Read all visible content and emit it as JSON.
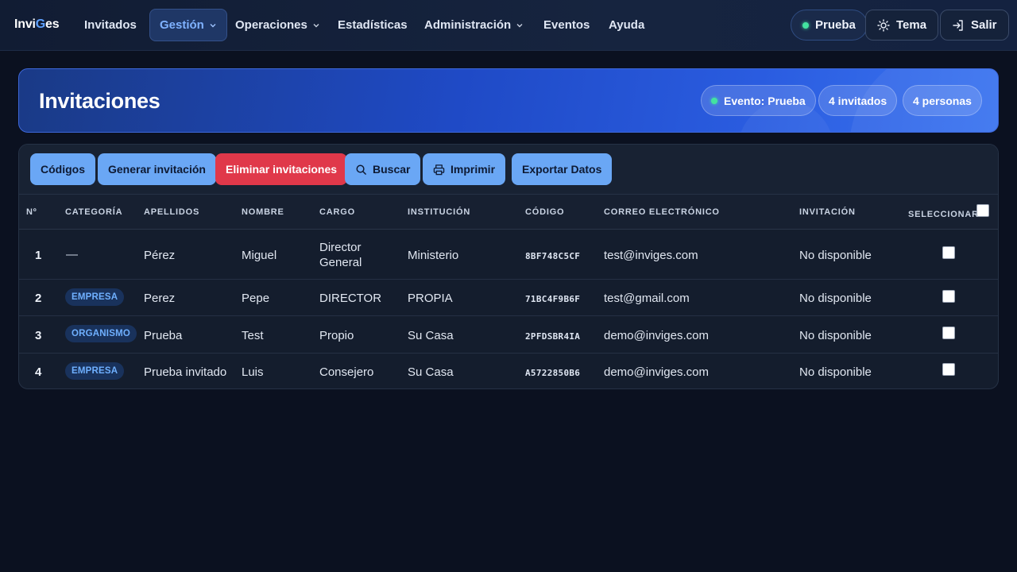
{
  "brand": {
    "part1": "Invi",
    "part2": "G",
    "part3": "es"
  },
  "nav": {
    "items": [
      "Invitados",
      "Gestión",
      "Operaciones",
      "Estadísticas",
      "Administración",
      "Eventos",
      "Ayuda"
    ],
    "active": "Gestión",
    "event_label": "Prueba",
    "theme_label": "Tema",
    "logout_label": "Salir"
  },
  "header": {
    "title": "Invitaciones",
    "event_pill": "Evento: Prueba",
    "guests_pill": "4 invitados",
    "people_pill": "4 personas"
  },
  "toolbar": {
    "codes": "Códigos",
    "generate": "Generar invitación",
    "delete": "Eliminar invitaciones",
    "search": "Buscar",
    "print": "Imprimir",
    "export": "Exportar Datos"
  },
  "table": {
    "headers": {
      "num": "Nº",
      "category": "Categoría",
      "surnames": "Apellidos",
      "name": "Nombre",
      "position": "Cargo",
      "institution": "Institución",
      "code": "Código",
      "email": "Correo electrónico",
      "invitation": "Invitación",
      "select": "Seleccionar"
    },
    "rows": [
      {
        "num": "1",
        "category": "—",
        "surnames": "Pérez",
        "name": "Miguel",
        "position_line1": "Director",
        "position_line2": "General",
        "institution": "Ministerio",
        "code": "8BF748C5CF",
        "email": "test@inviges.com",
        "invitation": "No disponible"
      },
      {
        "num": "2",
        "category": "EMPRESA",
        "surnames": "Perez",
        "name": "Pepe",
        "position": "DIRECTOR",
        "institution": "PROPIA",
        "code": "71BC4F9B6F",
        "email": "test@gmail.com",
        "invitation": "No disponible"
      },
      {
        "num": "3",
        "category": "ORGANISMO",
        "surnames": "Prueba",
        "name": "Test",
        "position": "Propio",
        "institution": "Su Casa",
        "code": "2PFDSBR4IA",
        "email": "demo@inviges.com",
        "invitation": "No disponible"
      },
      {
        "num": "4",
        "category": "EMPRESA",
        "surnames": "Prueba invitado",
        "name": "Luis",
        "position": "Consejero",
        "institution": "Su Casa",
        "code": "A5722850B6",
        "email": "demo@inviges.com",
        "invitation": "No disponible"
      }
    ]
  },
  "colors": {
    "background": "#0b1120",
    "accent": "#6aa7f5",
    "danger": "#e0384a",
    "banner": "#1f4ac6",
    "status_dot": "#43e3a0"
  }
}
